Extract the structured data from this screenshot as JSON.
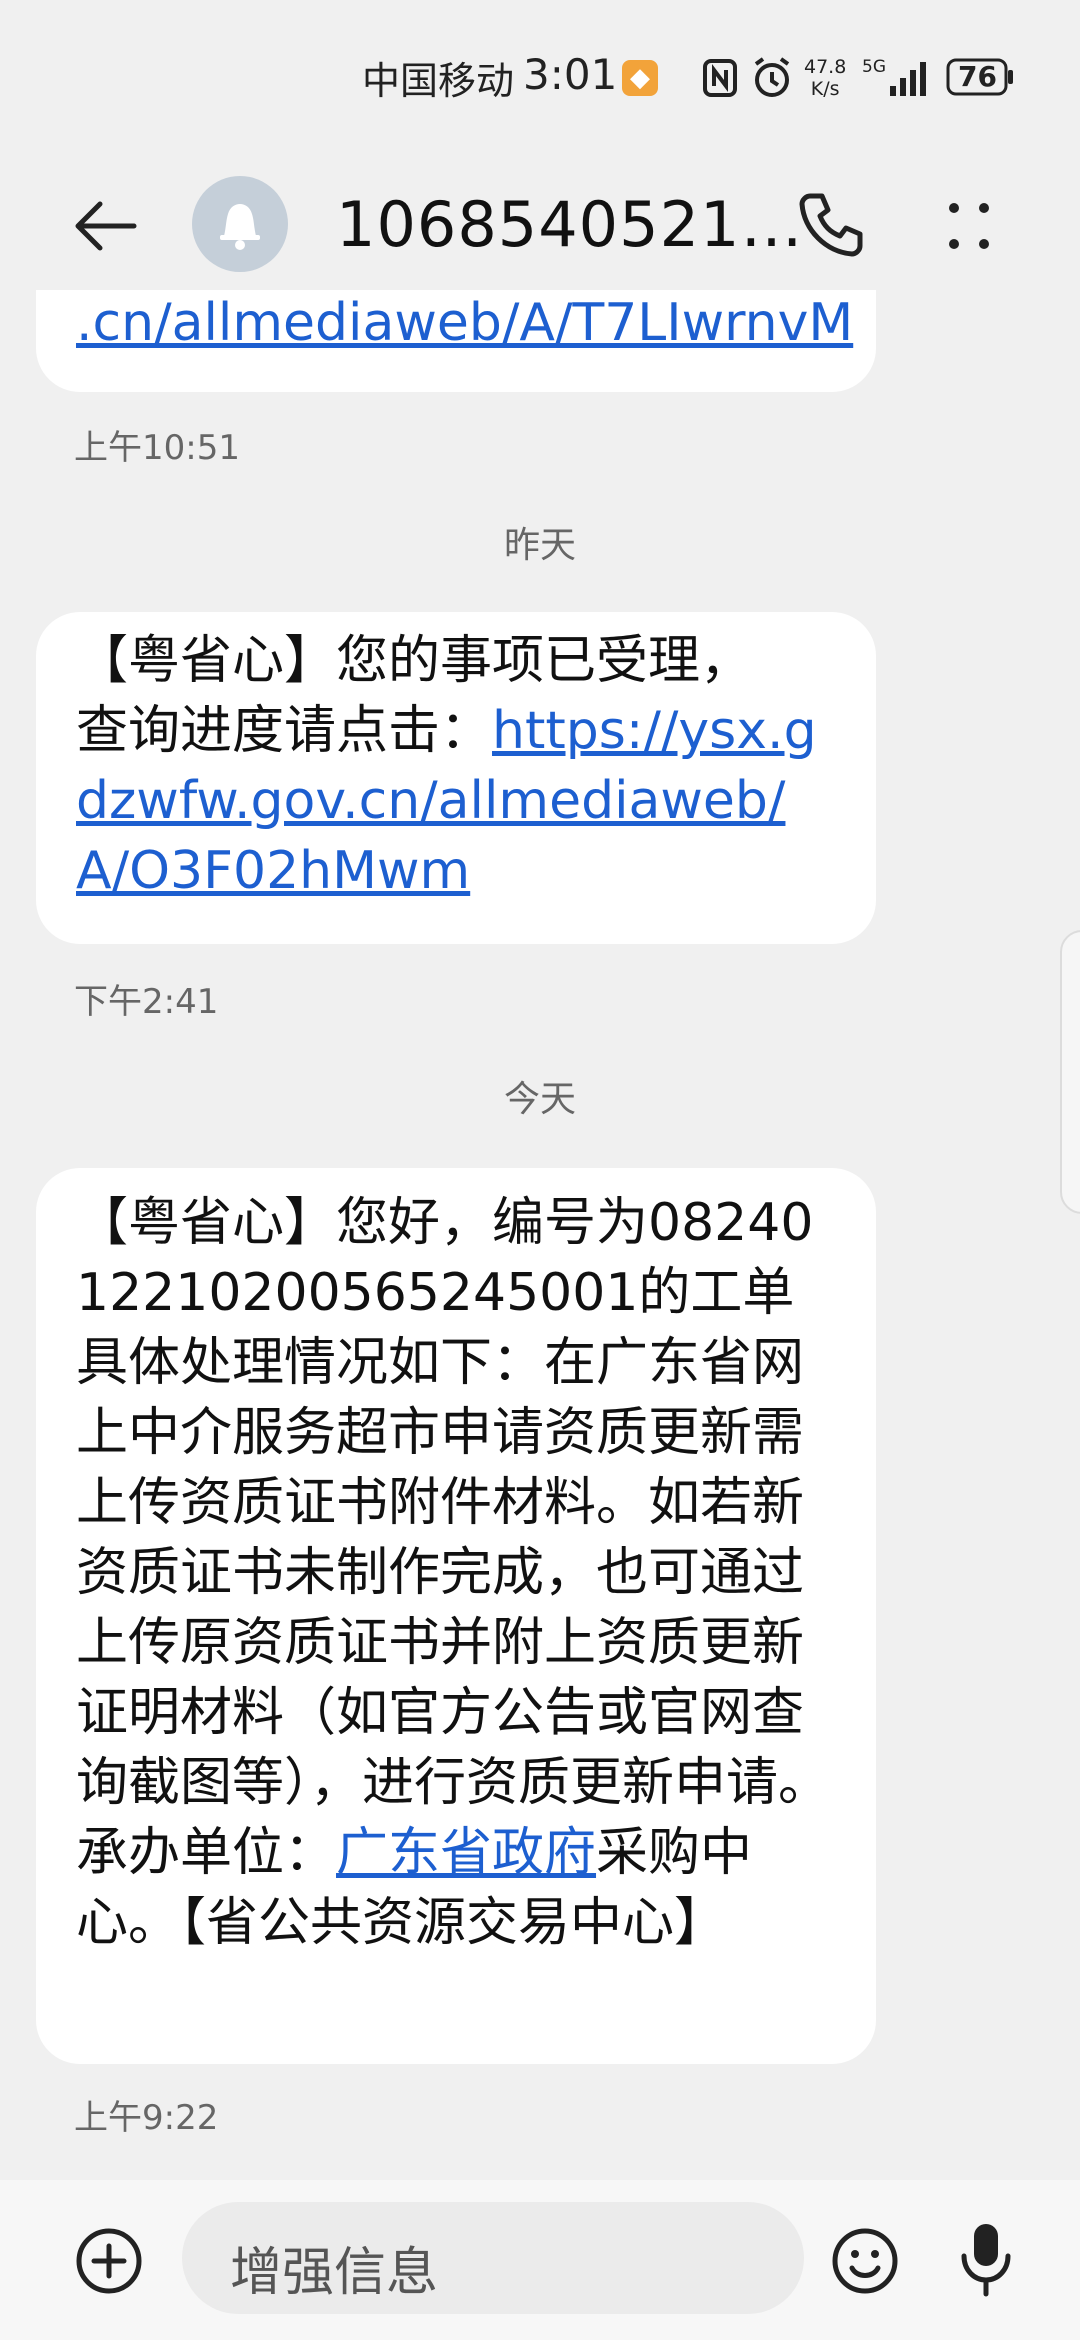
{
  "status_bar": {
    "carrier": "中国移动",
    "time": "3:01",
    "net_speed_value": "47.8",
    "net_speed_unit": "K/s",
    "network_type": "5G",
    "battery": "76"
  },
  "header": {
    "contact": "1068540521…",
    "icons": [
      "back-arrow-icon",
      "bell-icon",
      "phone-icon",
      "more-icon"
    ]
  },
  "messages": [
    {
      "segments": [
        {
          "text": ".cn/allmediaweb/A/T7LIwrnvM",
          "link": true
        }
      ],
      "time": "上午10:51"
    },
    {
      "day_label": "昨天",
      "segments": [
        {
          "text": "【粤省心】您的事项已受理，",
          "link": false
        },
        {
          "text": "查询进度请点击：",
          "link": false
        },
        {
          "text": "https://ysx.gdzwfw.gov.cn/allmediaweb/A/O3F02hMwm",
          "link": true
        }
      ],
      "time": "下午2:41"
    },
    {
      "day_label": "今天",
      "segments": [
        {
          "text": "【粤省心】您好，编号为082401221020056524500​1的工单具体处理情况如下：在广东省网上中介服务超市申请资质更新需上传资质证书附件材料。如若新资质证书未制作完成，也可通过上传原资质证书并附上资质更新证明材料（如官方公告或官网查询截图等），进行资质更新申请。承办单位：",
          "link": false
        },
        {
          "text": "广东省政府",
          "link": true
        },
        {
          "text": "采购中心。【省公共资源交易中心】",
          "link": false
        }
      ],
      "time": "上午9:22"
    }
  ],
  "composer": {
    "placeholder": "增强信息",
    "icons": [
      "add-icon",
      "emoji-icon",
      "microphone-icon"
    ]
  }
}
